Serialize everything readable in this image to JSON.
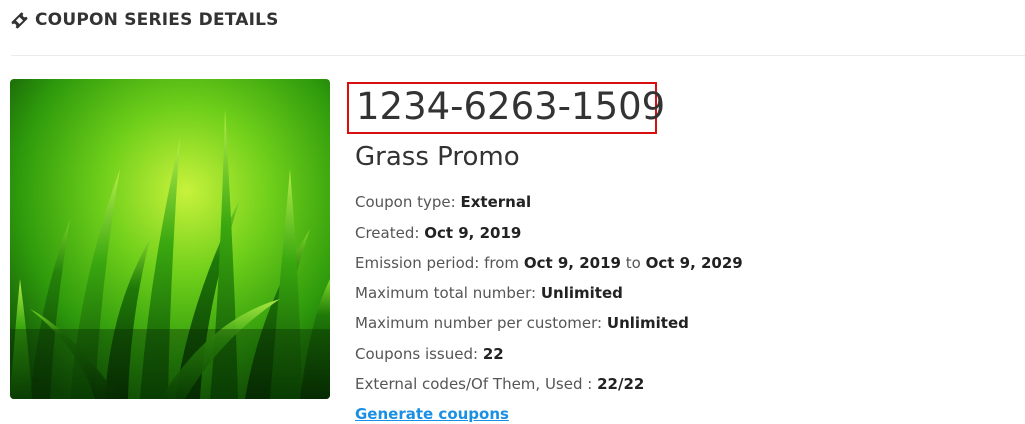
{
  "header": {
    "title": "COUPON SERIES DETAILS",
    "icon": "ticket-icon"
  },
  "series": {
    "code": "1234-6263-1509",
    "name": "Grass Promo",
    "image": "grass-image",
    "highlight_color": "#d80f0f"
  },
  "details": {
    "coupon_type_label": "Coupon type:",
    "coupon_type_value": "External",
    "created_label": "Created:",
    "created_value": "Oct 9, 2019",
    "emission_label": "Emission period: from",
    "emission_from": "Oct 9, 2019",
    "emission_to_label": "to",
    "emission_to": "Oct 9, 2029",
    "max_total_label": "Maximum total number:",
    "max_total_value": "Unlimited",
    "max_per_customer_label": "Maximum number per customer:",
    "max_per_customer_value": "Unlimited",
    "issued_label": "Coupons issued:",
    "issued_value": "22",
    "external_codes_label": "External codes/Of Them, Used :",
    "external_codes_value": "22/22"
  },
  "actions": {
    "generate_label": "Generate coupons",
    "link_color": "#1a8fe3"
  }
}
